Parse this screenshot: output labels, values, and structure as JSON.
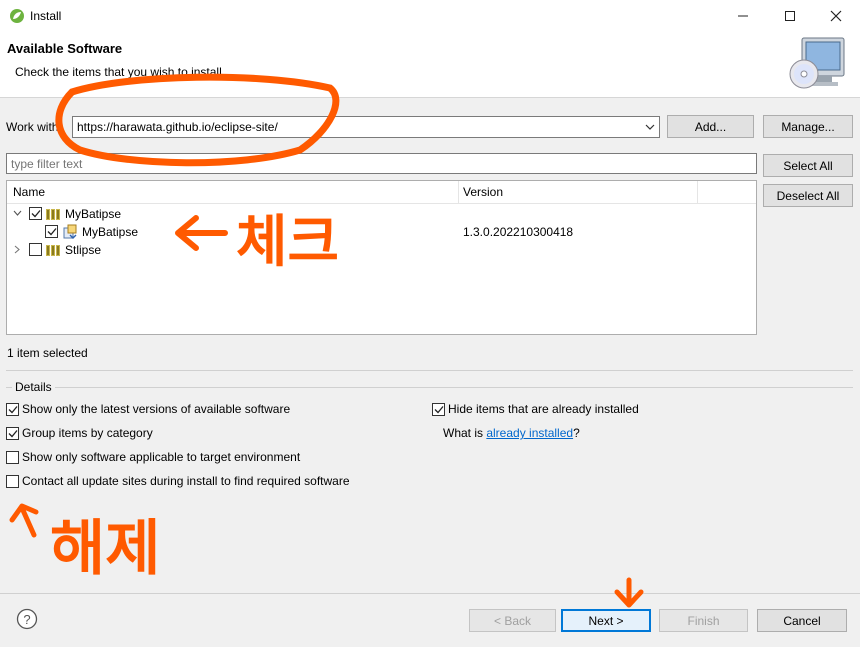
{
  "window": {
    "title": "Install"
  },
  "header": {
    "title": "Available Software",
    "subtitle": "Check the items that you wish to install."
  },
  "work_with": {
    "label": "Work with:",
    "value": "https://harawata.github.io/eclipse-site/",
    "add_label": "Add...",
    "manage_label": "Manage..."
  },
  "filter": {
    "placeholder": "type filter text"
  },
  "select_all_label": "Select All",
  "deselect_all_label": "Deselect All",
  "table": {
    "columns": [
      "Name",
      "Version"
    ],
    "rows": [
      {
        "name": "MyBatipse",
        "version": "",
        "checked": true,
        "expanded": true,
        "level": 0
      },
      {
        "name": "MyBatipse",
        "version": "1.3.0.202210300418",
        "checked": true,
        "level": 1
      },
      {
        "name": "Stlipse",
        "version": "",
        "checked": false,
        "expanded": false,
        "level": 0
      }
    ]
  },
  "status": "1 item selected",
  "details": {
    "label": "Details",
    "options": [
      {
        "label": "Show only the latest versions of available software",
        "checked": true
      },
      {
        "label": "Group items by category",
        "checked": true
      },
      {
        "label": "Show only software applicable to target environment",
        "checked": false
      },
      {
        "label": "Contact all update sites during install to find required software",
        "checked": false
      },
      {
        "label": "Hide items that are already installed",
        "checked": true
      }
    ],
    "what_is_prefix": "What is ",
    "already_installed_link": "already installed",
    "what_is_suffix": "?"
  },
  "footer": {
    "back_label": "< Back",
    "next_label": "Next >",
    "finish_label": "Finish",
    "cancel_label": "Cancel"
  },
  "annotations": {
    "check_note": "체크",
    "uncheck_note": "해제"
  },
  "colors": {
    "accent": "#0078d7",
    "annotation": "#ff5a00",
    "link": "#0066cc"
  }
}
